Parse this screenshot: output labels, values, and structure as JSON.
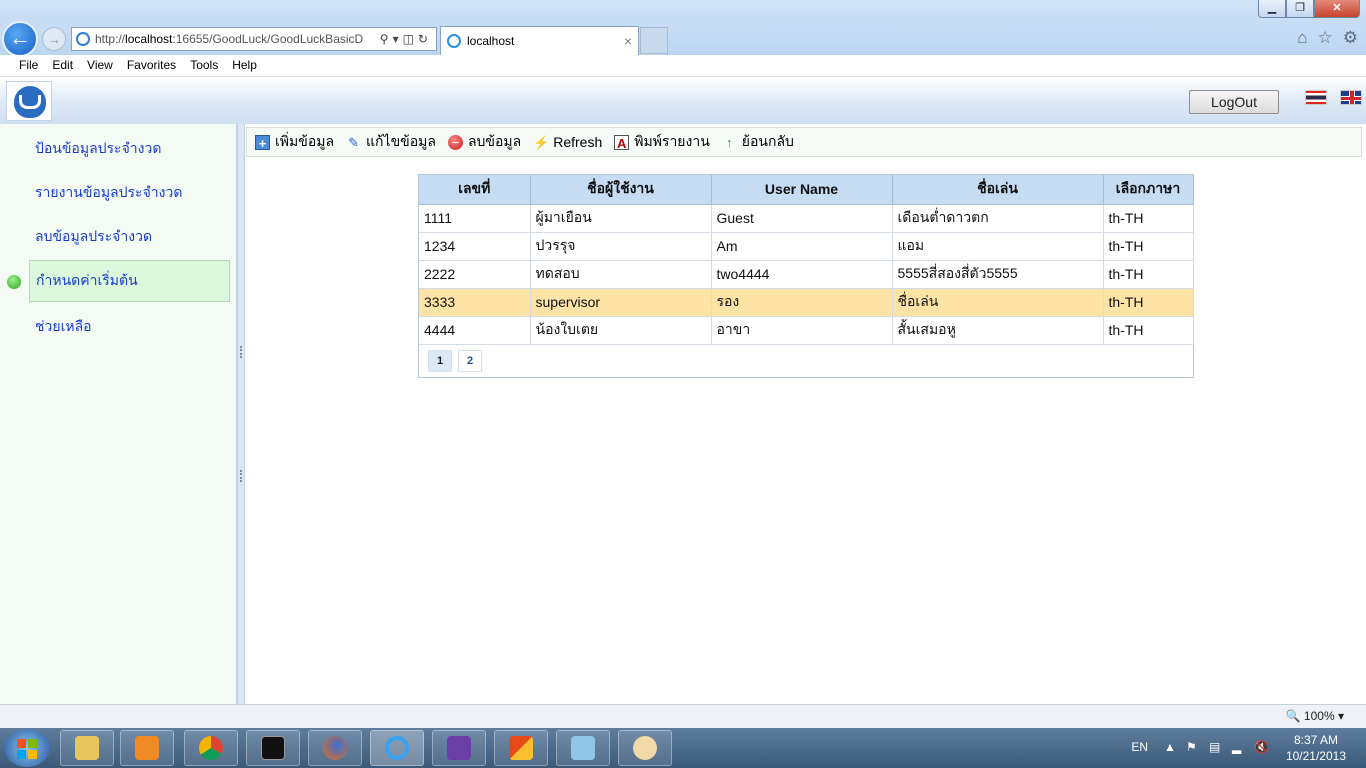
{
  "browser": {
    "url_prefix": "http://",
    "url_host": "localhost",
    "url_rest": ":16655/GoodLuck/GoodLuckBasicD",
    "tab_title": "localhost",
    "window_buttons": {
      "minimize": "▁",
      "restore": "❐",
      "close": "✕"
    },
    "menu": [
      "File",
      "Edit",
      "View",
      "Favorites",
      "Tools",
      "Help"
    ]
  },
  "header": {
    "logout_label": "LogOut"
  },
  "sidebar": {
    "items": [
      {
        "label": "ป้อนข้อมูลประจำงวด",
        "active": false
      },
      {
        "label": "รายงานข้อมูลประจำงวด",
        "active": false
      },
      {
        "label": "ลบข้อมูลประจำงวด",
        "active": false
      },
      {
        "label": "กำหนดค่าเริ่มต้น",
        "active": true
      },
      {
        "label": "ช่วยเหลือ",
        "active": false
      }
    ]
  },
  "toolbar": {
    "add_label": "เพิ่มข้อมูล",
    "edit_label": "แก้ไขข้อมูล",
    "delete_label": "ลบข้อมูล",
    "refresh_label": "Refresh",
    "print_label": "พิมพ์รายงาน",
    "back_label": "ย้อนกลับ"
  },
  "grid": {
    "columns": [
      "เลขที่",
      "ชื่อผู้ใช้งาน",
      "User Name",
      "ชื่อเล่น",
      "เลือกภาษา"
    ],
    "rows": [
      [
        "1111",
        "ผู้มาเยือน",
        "Guest",
        "เดือนต่ำดาวตก",
        "th-TH"
      ],
      [
        "1234",
        "ปวรรุจ",
        "Am",
        "แอม",
        "th-TH"
      ],
      [
        "2222",
        "ทดสอบ",
        "two4444",
        "5555สี่สองสี่ตัว5555",
        "th-TH"
      ],
      [
        "3333",
        "supervisor",
        "รอง",
        "ชื่อเล่น",
        "th-TH"
      ],
      [
        "4444",
        "น้องใบเตย",
        "อาขา",
        "สั้นเสมอหู",
        "th-TH"
      ]
    ],
    "selected_row": 3,
    "pages": [
      "1",
      "2"
    ],
    "current_page": "1"
  },
  "statusbar": {
    "zoom": "100%"
  },
  "taskbar": {
    "lang": "EN",
    "time": "8:37 AM",
    "date": "10/21/2013"
  },
  "colors": {
    "nav_link": "#1a3ccc",
    "header_row": "#c6dcf3",
    "selected_row": "#fee3a6",
    "active_nav": "#dcf8dc"
  }
}
